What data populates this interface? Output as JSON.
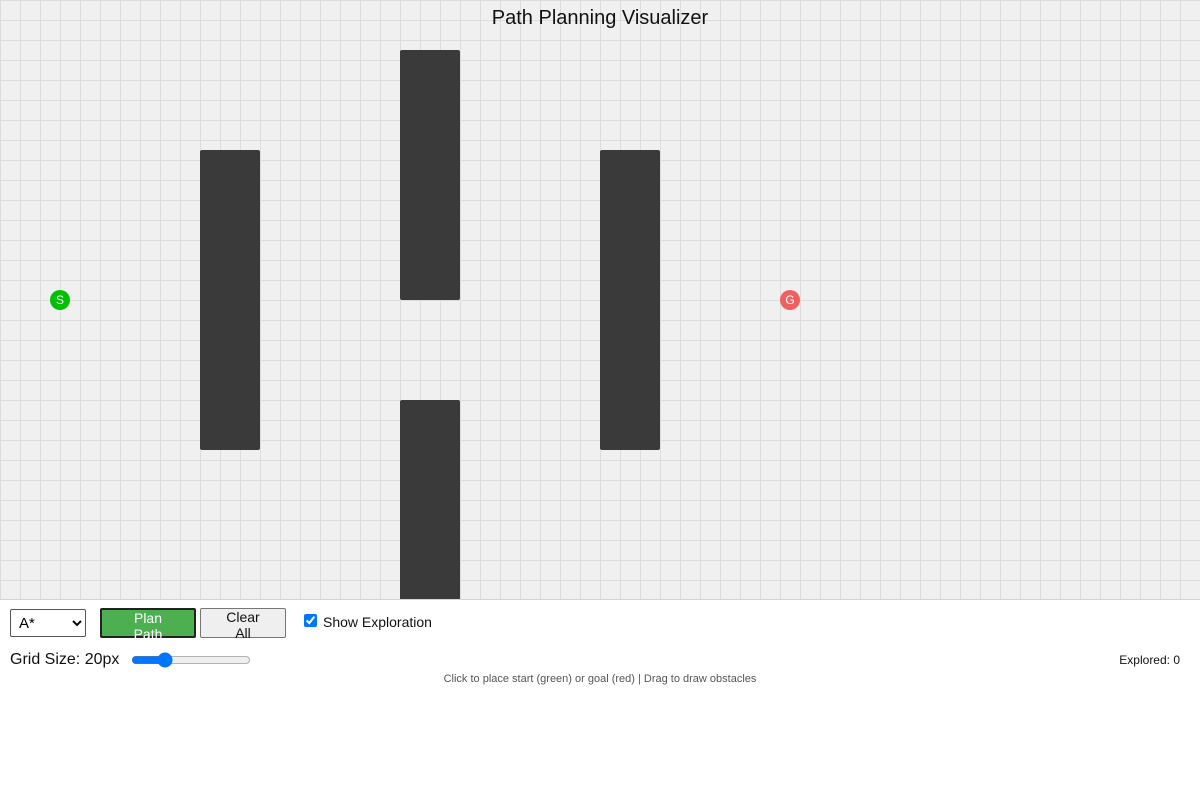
{
  "header": {
    "title": "Path Planning Visualizer"
  },
  "grid": {
    "cell_size_px": 20,
    "obstacle_color": "#3a3a3a",
    "background_color": "#f0f0f0"
  },
  "markers": {
    "start": {
      "label": "S",
      "color": "#00c000"
    },
    "goal": {
      "label": "G",
      "color": "#f06060"
    }
  },
  "controls": {
    "algorithm_selected": "A*",
    "algorithm_options": [
      "A*"
    ],
    "plan_button_label": "Plan Path",
    "plan_button_color": "#4caf50",
    "clear_button_label": "Clear All",
    "show_exploration_label": "Show Exploration",
    "show_exploration_checked": true
  },
  "grid_size": {
    "label": "Grid Size: 20px",
    "value": 20
  },
  "stats": {
    "explored_label": "Explored: 0"
  },
  "hint": "Click to place start (green) or goal (red) | Drag to draw obstacles"
}
